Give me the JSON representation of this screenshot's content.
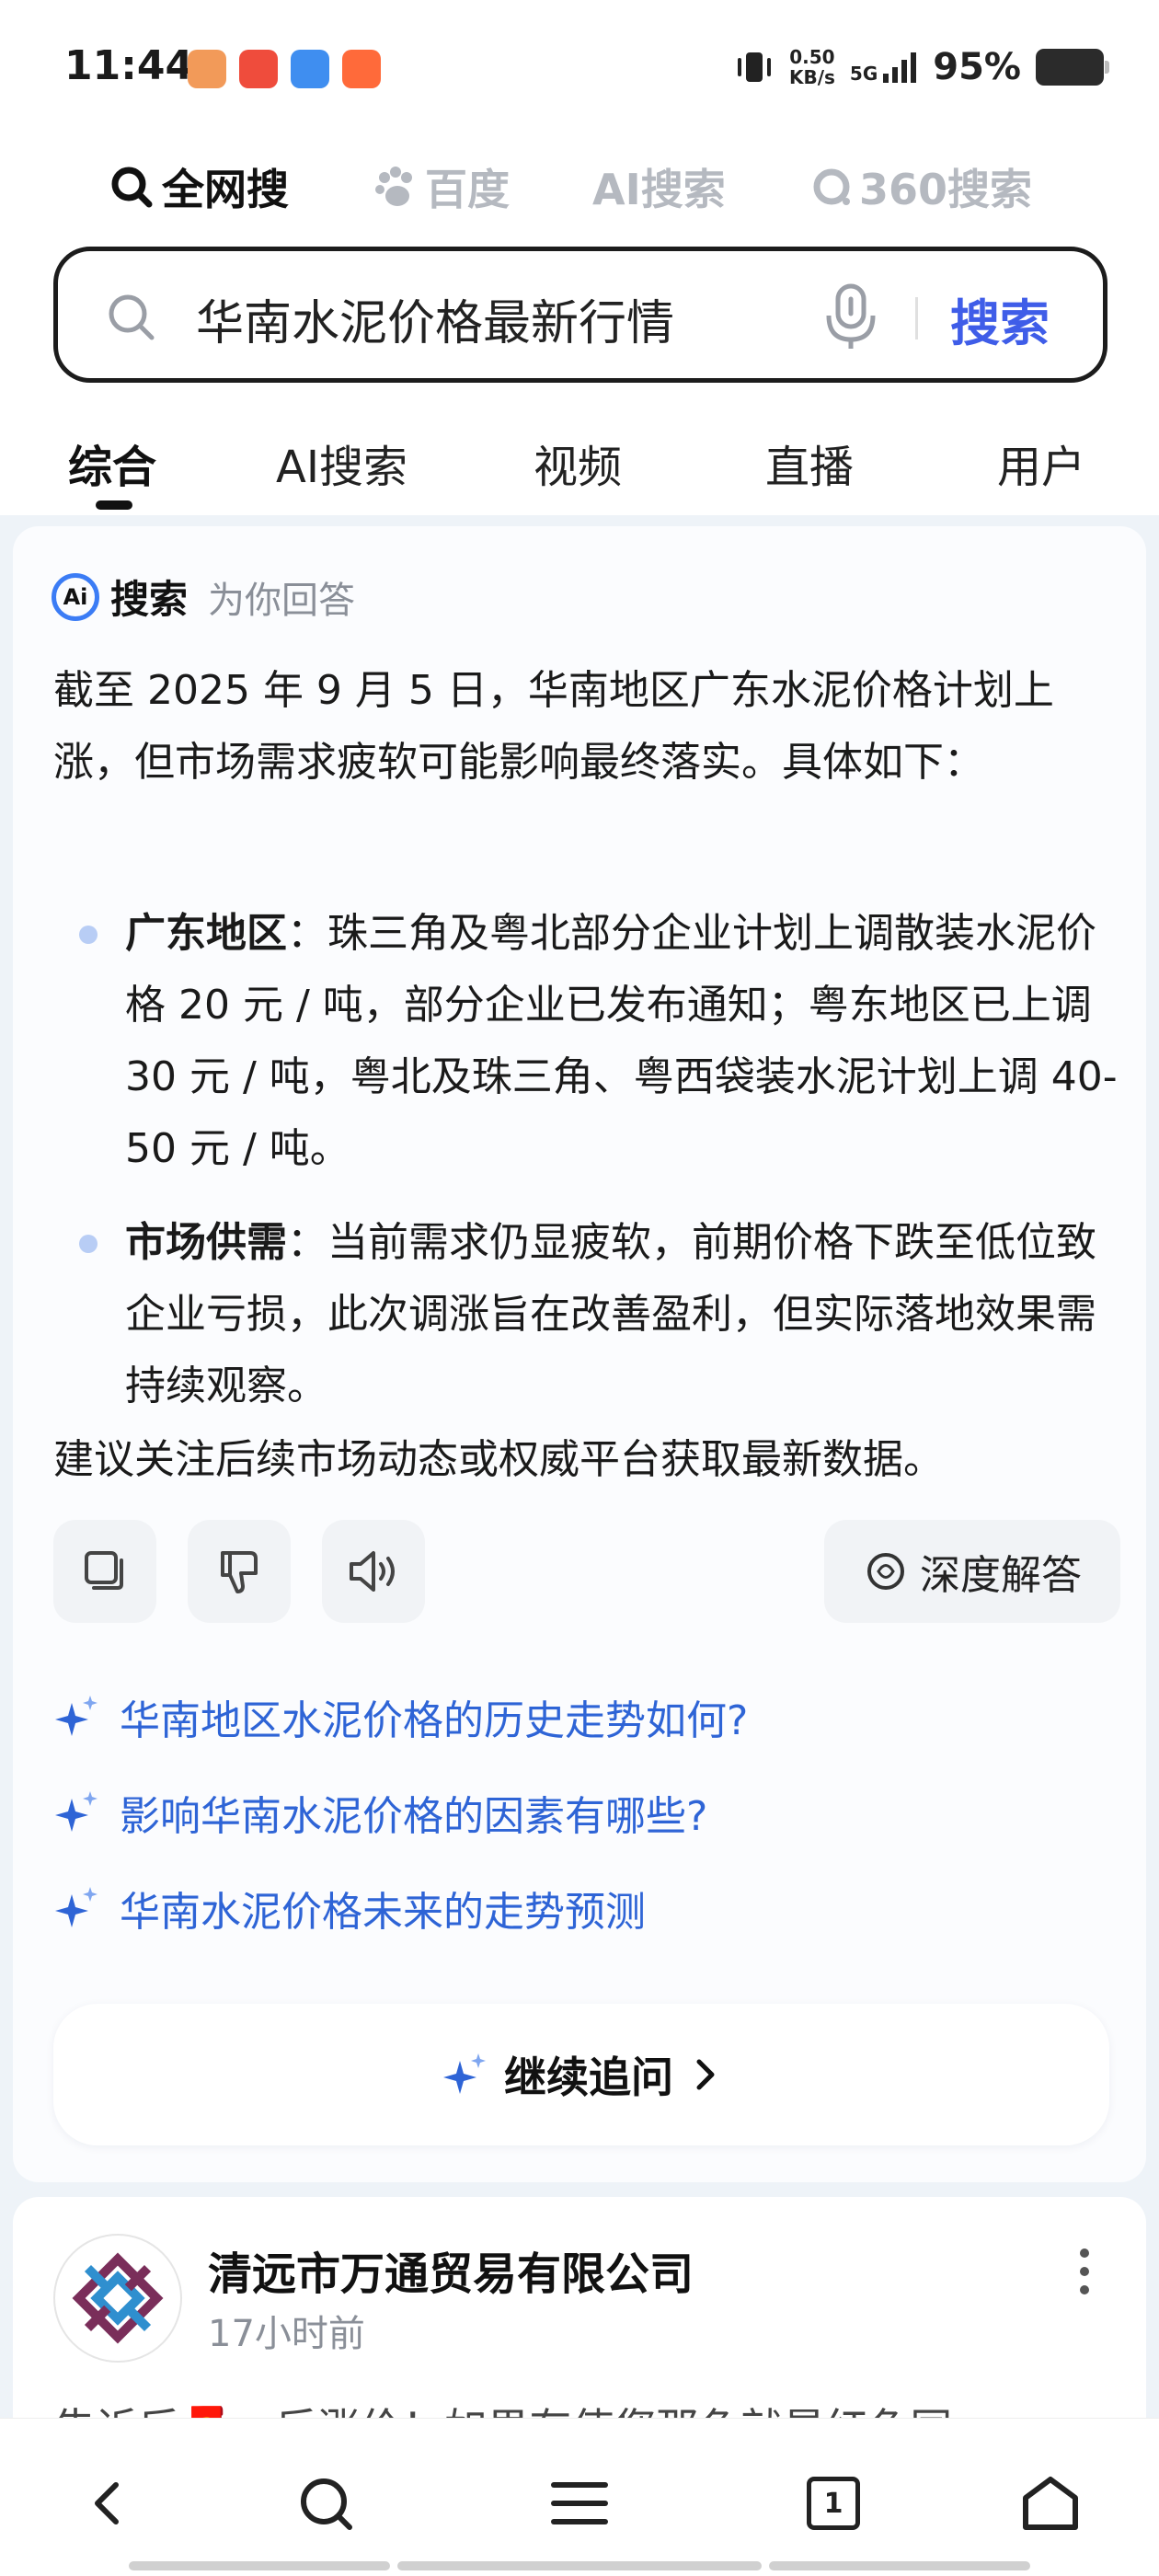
{
  "status_bar": {
    "time": "11:44",
    "net_speed_value": "0.50",
    "net_speed_unit": "KB/s",
    "network": "5G",
    "battery": "95%",
    "icons": [
      "vibrate-icon",
      "signal-icon",
      "battery-icon"
    ],
    "app_notification_colors": [
      "#f29a59",
      "#ef4c3c",
      "#3f8ef0",
      "#ff6a3a"
    ]
  },
  "engines": {
    "items": [
      {
        "label": "全网搜",
        "icon": "search-icon",
        "active": true
      },
      {
        "label": "百度",
        "icon": "paw-icon",
        "active": false
      },
      {
        "label": "AI搜索",
        "icon": "",
        "active": false
      },
      {
        "label": "360搜索",
        "icon": "circle-icon",
        "active": false
      }
    ]
  },
  "search": {
    "query": "华南水泥价格最新行情",
    "button_label": "搜索",
    "accent_color": "#3f5de8"
  },
  "tabs": {
    "items": [
      "综合",
      "AI搜索",
      "视频",
      "直播",
      "用户"
    ],
    "active_index": 0
  },
  "ai_answer": {
    "logo_text": "Ai",
    "title": "搜索",
    "subtitle": "为你回答",
    "intro": "截至 2025 年 9 月 5 日，华南地区广东水泥价格计划上涨，但市场需求疲软可能影响最终落实。具体如下：",
    "bullets": [
      {
        "heading": "广东地区",
        "text": "：珠三角及粤北部分企业计划上调散装水泥价格 20 元 / 吨，部分企业已发布通知；粤东地区已上调 30 元 / 吨，粤北及珠三角、粤西袋装水泥计划上调 40-50 元 / 吨。"
      },
      {
        "heading": "市场供需",
        "text": "：当前需求仍显疲软，前期价格下跌至低位致企业亏损，此次调涨旨在改善盈利，但实际落地效果需持续观察。"
      }
    ],
    "outro": "建议关注后续市场动态或权威平台获取最新数据。",
    "deep_answer_label": "深度解答",
    "suggestions": [
      "华南地区水泥价格的历史走势如何?",
      "影响华南水泥价格的因素有哪些?",
      "华南水泥价格未来的走势预测"
    ],
    "follow_up_label": "继续追问",
    "link_color": "#2e64d6"
  },
  "result": {
    "author": "清远市万通贸易有限公司",
    "time": "17小时前",
    "snippet": "告诉后🧧，后涨价！如果有使您那色就是红色同"
  },
  "bottom_nav": {
    "tab_count": "1",
    "icons": [
      "back-icon",
      "search-icon",
      "menu-icon",
      "tabs-icon",
      "home-icon"
    ]
  }
}
